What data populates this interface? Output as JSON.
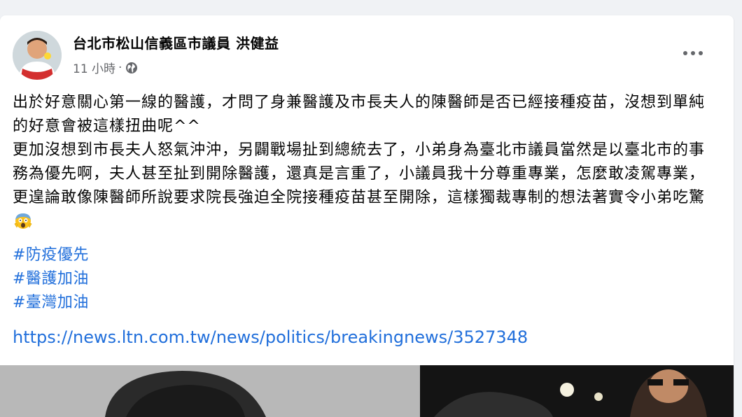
{
  "post": {
    "author": "台北市松山信義區市議員 洪健益",
    "time": "11 小時",
    "separator": "·",
    "privacy_icon": "globe-icon",
    "more_icon": "more-options-icon",
    "paragraph_1": "出於好意關心第一線的醫護，才問了身兼醫護及市長夫人的陳醫師是否已經接種疫苗，沒想到單純的好意會被這樣扭曲呢^^",
    "paragraph_2": "更加沒想到市長夫人怒氣沖沖，另闢戰場扯到總統去了，小弟身為臺北市議員當然是以臺北市的事務為優先啊，夫人甚至扯到開除醫護，還真是言重了，小議員我十分尊重專業，怎麼敢凌駕專業，更遑論敢像陳醫師所說要求院長強迫全院接種疫苗甚至開除，這樣獨裁專制的想法著實令小弟吃驚",
    "emoji_icon": "scream-emoji-icon",
    "hashtags": [
      "#防疫優先",
      "#醫護加油",
      "#臺灣加油"
    ],
    "link": "https://news.ltn.com.tw/news/politics/breakingnews/3527348"
  },
  "colors": {
    "link": "#216fdb",
    "muted": "#65676b",
    "text": "#050505",
    "background": "#f0f2f5"
  }
}
